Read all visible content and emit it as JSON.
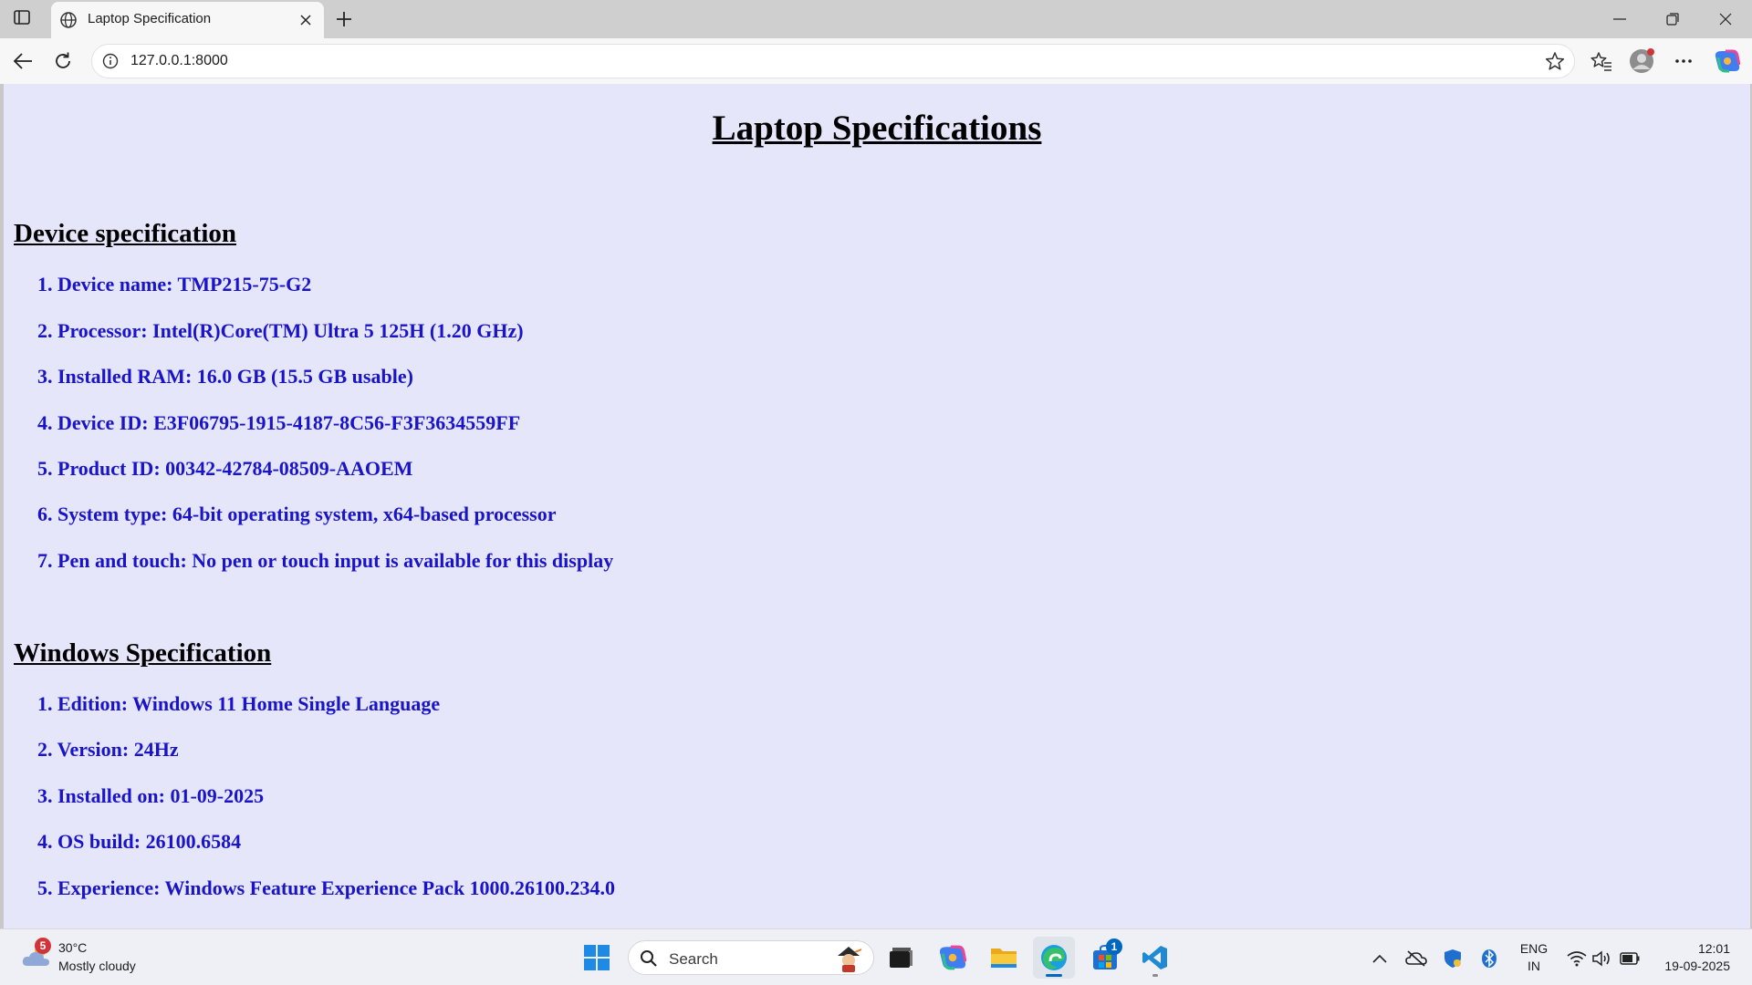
{
  "browser": {
    "tab_title": "Laptop Specification",
    "url": "127.0.0.1:8000"
  },
  "page": {
    "title": "Laptop Specifications",
    "sections": [
      {
        "heading": "Device specification",
        "items": [
          "1. Device name: TMP215-75-G2",
          "2. Processor: Intel(R)Core(TM) Ultra 5 125H (1.20 GHz)",
          "3. Installed RAM: 16.0 GB (15.5 GB usable)",
          "4. Device ID: E3F06795-1915-4187-8C56-F3F3634559FF",
          "5. Product ID: 00342-42784-08509-AAOEM",
          "6. System type: 64-bit operating system, x64-based processor",
          "7. Pen and touch: No pen or touch input is available for this display"
        ]
      },
      {
        "heading": "Windows Specification",
        "items": [
          "1. Edition: Windows 11 Home Single Language",
          "2. Version: 24Hz",
          "3. Installed on: 01-09-2025",
          "4. OS build: 26100.6584",
          "5. Experience: Windows Feature Experience Pack 1000.26100.234.0"
        ]
      }
    ]
  },
  "taskbar": {
    "weather_badge": "5",
    "temperature": "30°C",
    "condition": "Mostly cloudy",
    "search_placeholder": "Search",
    "store_badge": "1",
    "language_line1": "ENG",
    "language_line2": "IN",
    "time": "12:01",
    "date": "19-09-2025"
  },
  "colors": {
    "page_background": "#e6e6fa",
    "item_text": "#1a14c9",
    "heading_text": "#000000",
    "accent": "#0067c0"
  },
  "icons": [
    "tab-actions-icon",
    "globe-icon",
    "close-icon",
    "plus-icon",
    "minimize-icon",
    "restore-icon",
    "back-arrow-icon",
    "refresh-icon",
    "info-icon",
    "star-icon",
    "favorites-icon",
    "profile-icon",
    "more-icon",
    "copilot-icon",
    "weather-icon",
    "windows-start-icon",
    "search-icon",
    "task-view-icon",
    "copilot-app-icon",
    "file-explorer-icon",
    "edge-icon",
    "store-icon",
    "vscode-icon",
    "chevron-up-icon",
    "onedrive-icon",
    "defender-icon",
    "bluetooth-icon",
    "wifi-icon",
    "volume-icon",
    "battery-icon"
  ]
}
